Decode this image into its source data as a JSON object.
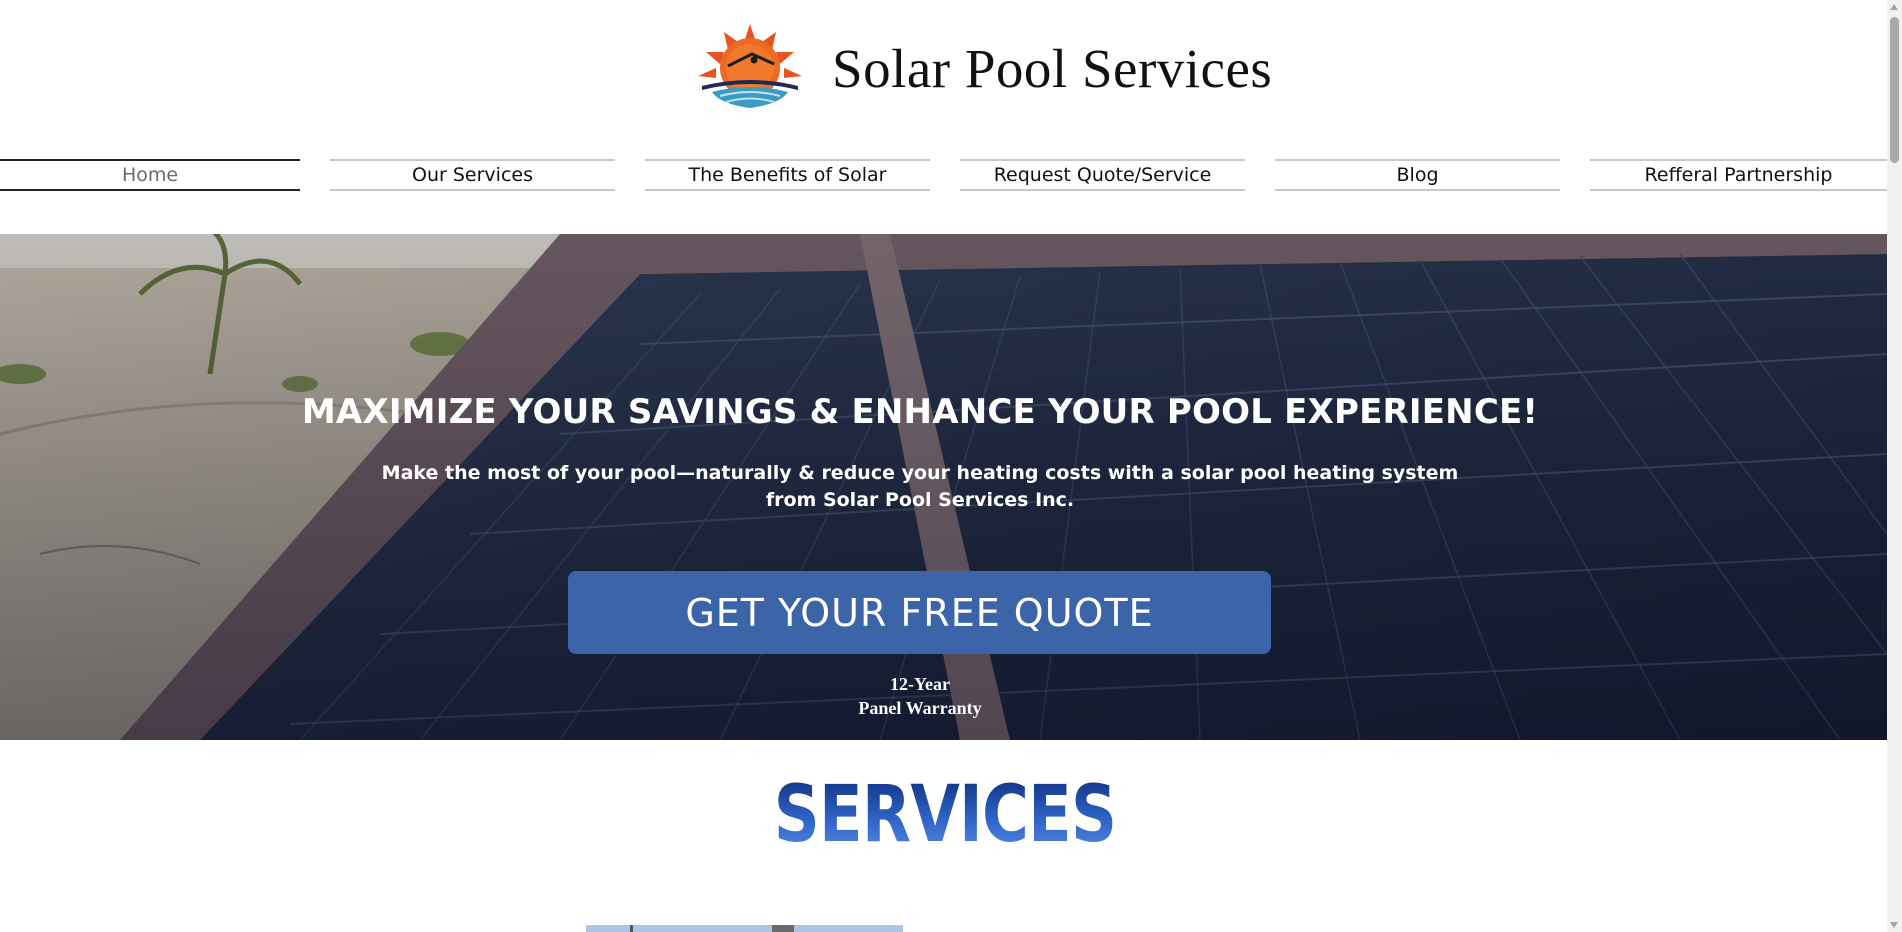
{
  "site": {
    "title": "Solar Pool Services"
  },
  "nav": {
    "items": [
      {
        "label": "Home",
        "active": true
      },
      {
        "label": "Our Services",
        "active": false
      },
      {
        "label": "The Benefits of Solar",
        "active": false
      },
      {
        "label": "Request Quote/Service",
        "active": false
      },
      {
        "label": "Blog",
        "active": false
      },
      {
        "label": "Refferal Partnership",
        "active": false
      }
    ]
  },
  "hero": {
    "title": "MAXIMIZE YOUR SAVINGS & ENHANCE YOUR POOL EXPERIENCE!",
    "subtitle": "Make the most of your pool—naturally & reduce your heating costs with a solar pool heating system from Solar Pool Services Inc.",
    "cta_label": "GET YOUR FREE QUOTE",
    "warranty_line1": "12-Year",
    "warranty_line2": "Panel Warranty"
  },
  "services": {
    "heading": "SERVICES"
  },
  "colors": {
    "cta_background": "#3b65a8",
    "services_heading_dark": "#0e2a78",
    "services_heading_light": "#5a8ee6",
    "logo_sun": "#e8531f",
    "logo_water": "#3a9cc2"
  },
  "icons": {
    "logo": "sun-over-water-logo"
  }
}
